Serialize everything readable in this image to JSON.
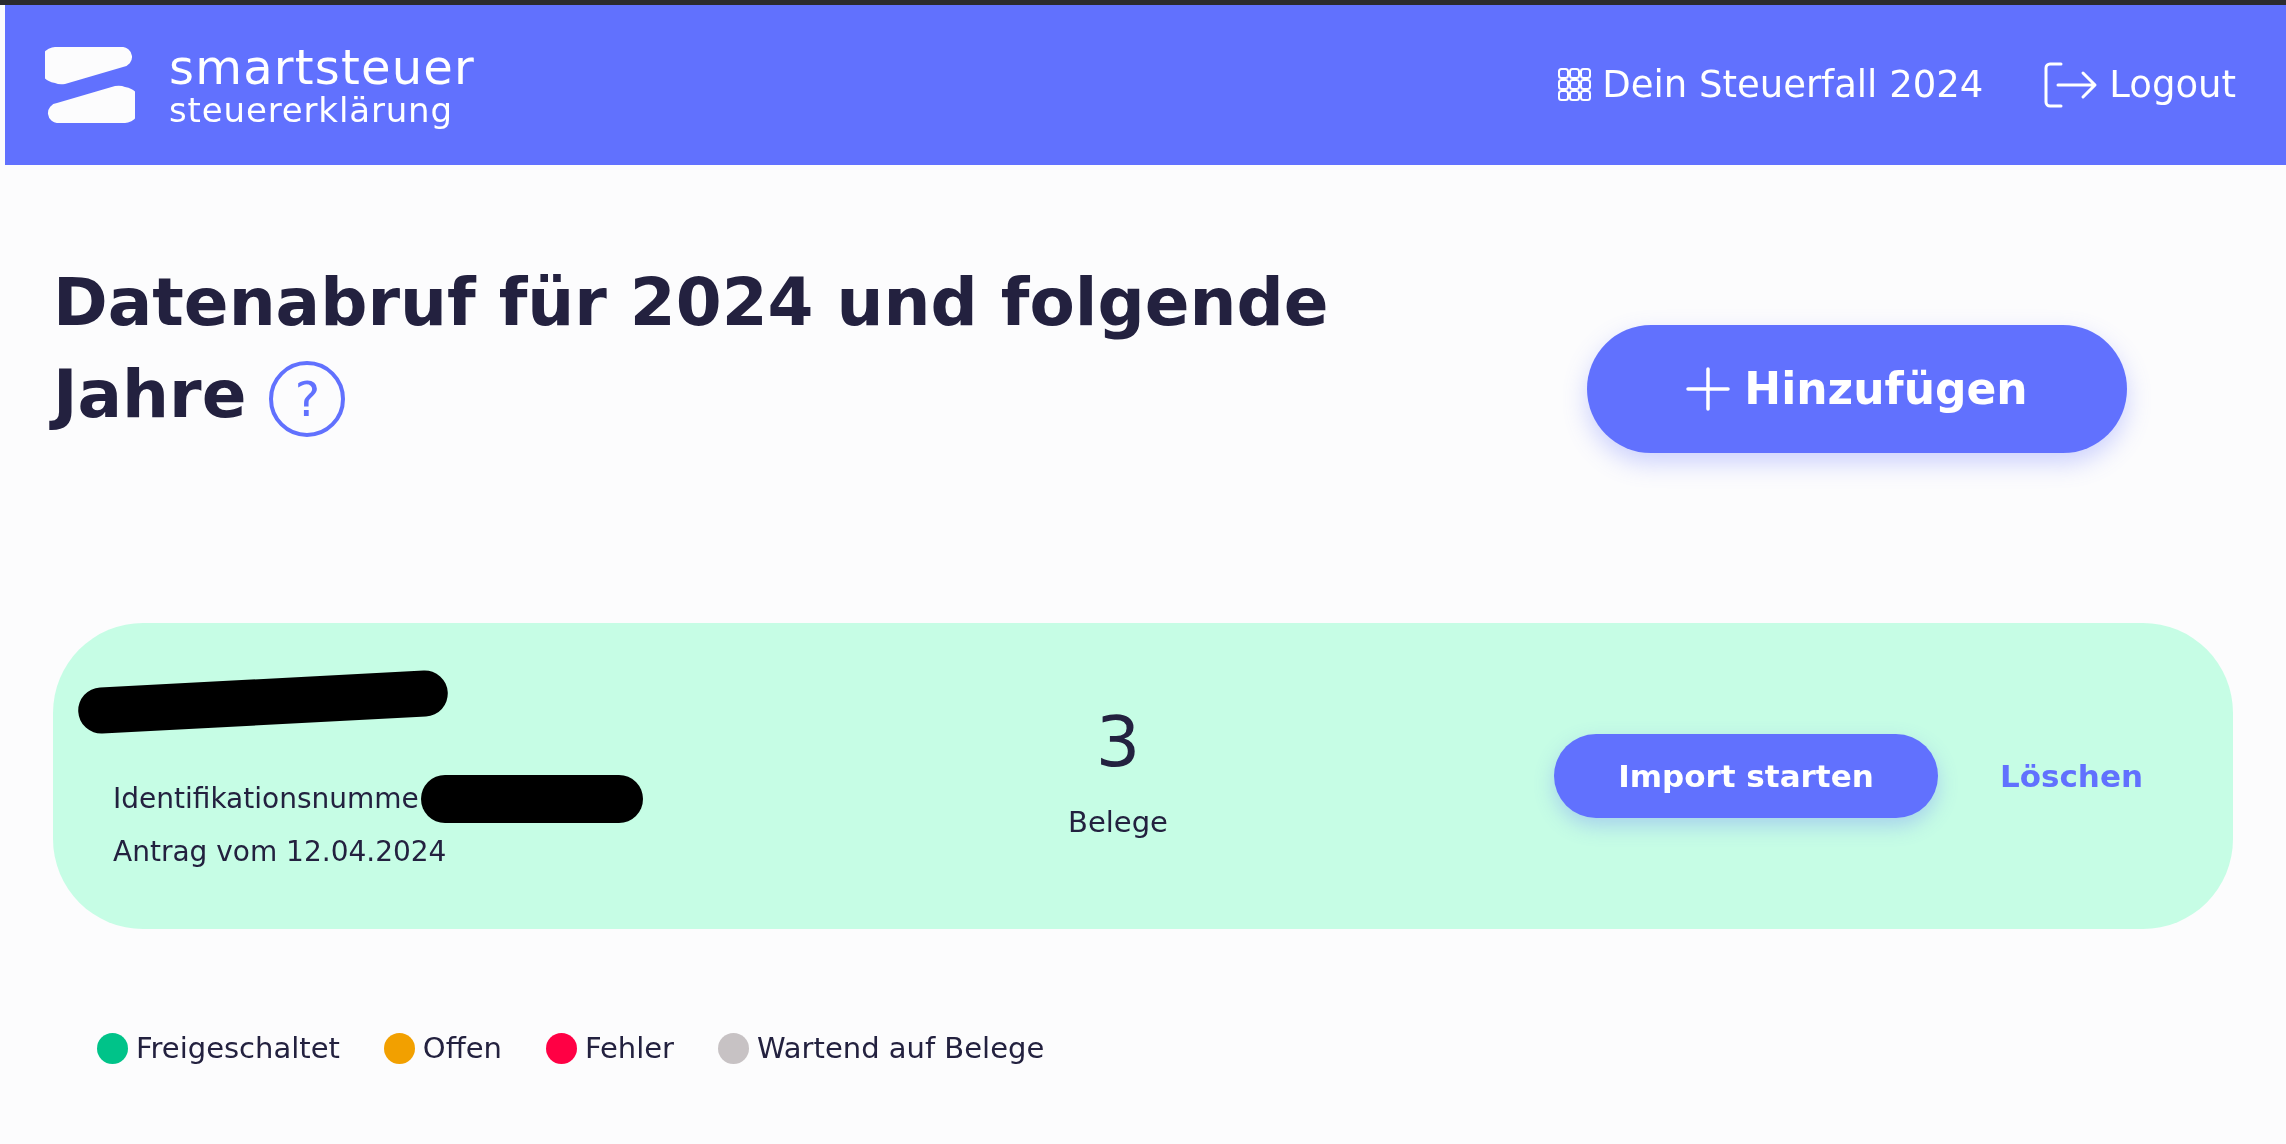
{
  "header": {
    "logo": {
      "name": "smartsteuer",
      "tagline": "steuererklärung"
    },
    "nav": [
      {
        "kind": "grid",
        "label": "Dein Steuerfall 2024"
      },
      {
        "kind": "logout",
        "label": "Logout"
      }
    ]
  },
  "page": {
    "title": "Datenabruf für 2024 und folgende Jahre",
    "help_icon": "?",
    "add_button": "Hinzufügen"
  },
  "card": {
    "id_label": "Identifikationsnumme",
    "date": "Antrag vom 12.04.2024",
    "count": "3",
    "count_label": "Belege",
    "import_button": "Import starten",
    "delete_link": "Löschen"
  },
  "legend": [
    {
      "label": "Freigeschaltet",
      "color": "#00c389"
    },
    {
      "label": "Offen",
      "color": "#f2a000"
    },
    {
      "label": "Fehler",
      "color": "#ff0044"
    },
    {
      "label": "Wartend auf Belege",
      "color": "#c7c2c4"
    }
  ]
}
